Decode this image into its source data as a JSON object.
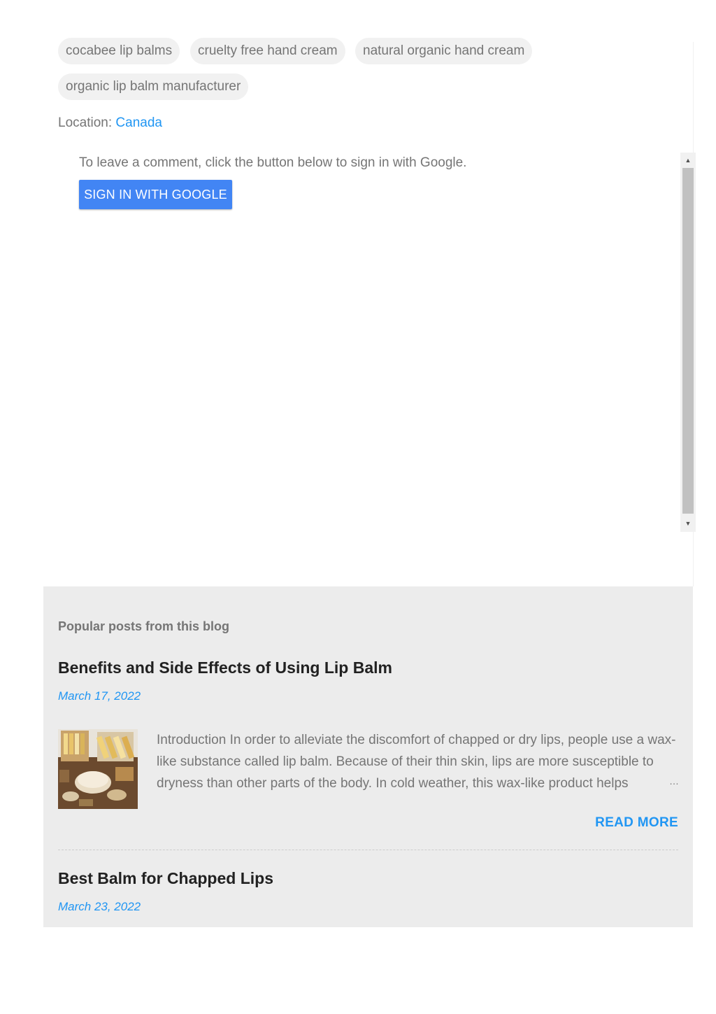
{
  "labels": [
    "cocabee lip balms",
    "cruelty free hand cream",
    "natural organic hand cream",
    "organic lip balm manufacturer"
  ],
  "location": {
    "prefix": "Location:",
    "value": "Canada"
  },
  "comments": {
    "prompt": "To leave a comment, click the button below to sign in with Google.",
    "signin_button": "SIGN IN WITH GOOGLE"
  },
  "popular": {
    "heading": "Popular posts from this blog",
    "posts": [
      {
        "title": "Benefits and Side Effects of Using Lip Balm",
        "date": "March 17, 2022",
        "snippet": "Introduction In order to alleviate the discomfort of chapped or dry lips, people use a wax-like substance called lip balm. Because of their thin skin, lips are more susceptible to dryness than other parts of the body. In cold weather, this wax-like product helps",
        "ellipsis": "…",
        "read_more": "READ MORE"
      },
      {
        "title": "Best Balm for Chapped Lips",
        "date": "March 23, 2022"
      }
    ]
  },
  "colors": {
    "accent": "#2196f3",
    "button": "#4285f4",
    "popular_bg": "#ececec",
    "chip_bg": "#f1f1f1"
  }
}
